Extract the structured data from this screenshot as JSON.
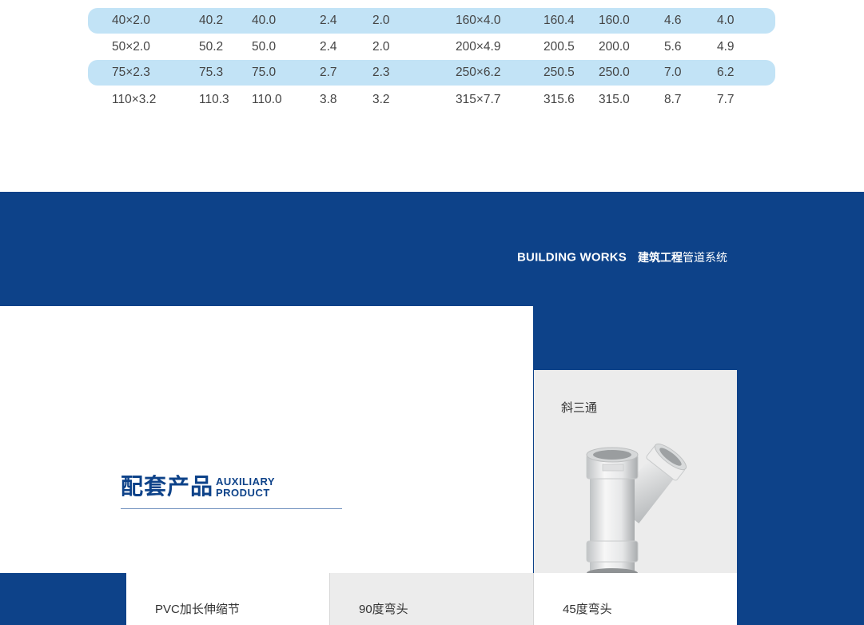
{
  "spec_table": {
    "rows": [
      {
        "highlight": true,
        "cells": [
          "40×2.0",
          "40.2",
          "40.0",
          "2.4",
          "2.0",
          "160×4.0",
          "160.4",
          "160.0",
          "4.6",
          "4.0"
        ]
      },
      {
        "highlight": false,
        "cells": [
          "50×2.0",
          "50.2",
          "50.0",
          "2.4",
          "2.0",
          "200×4.9",
          "200.5",
          "200.0",
          "5.6",
          "4.9"
        ]
      },
      {
        "highlight": true,
        "cells": [
          "75×2.3",
          "75.3",
          "75.0",
          "2.7",
          "2.3",
          "250×6.2",
          "250.5",
          "250.0",
          "7.0",
          "6.2"
        ]
      },
      {
        "highlight": false,
        "cells": [
          "110×3.2",
          "110.3",
          "110.0",
          "3.8",
          "3.2",
          "315×7.7",
          "315.6",
          "315.0",
          "8.7",
          "7.7"
        ]
      }
    ]
  },
  "brand": {
    "en": "BUILDING WORKS",
    "cn_bold": "建筑工程",
    "cn_regular": "管道系统"
  },
  "auxiliary": {
    "title_cn": "配套产品",
    "title_en_line1": "AUXILIARY",
    "title_en_line2": "PRODUCT"
  },
  "products": {
    "featured": {
      "label": "斜三通",
      "icon": "y-tee-pipe-icon"
    },
    "categories": [
      {
        "label": "PVC加长伸缩节"
      },
      {
        "label": "90度弯头"
      },
      {
        "label": "45度弯头"
      }
    ]
  },
  "colors": {
    "brand_blue": "#0d4289",
    "row_highlight": "#c2e3f6",
    "panel_gray": "#ececec"
  }
}
